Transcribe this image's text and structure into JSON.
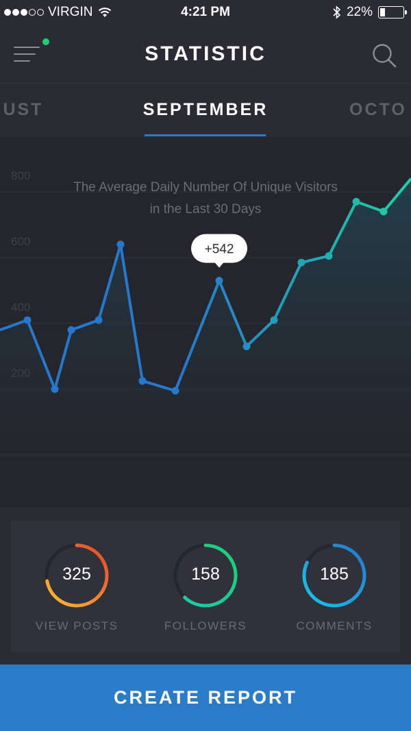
{
  "status_bar": {
    "carrier": "VIRGIN",
    "time": "4:21 PM",
    "battery": "22%",
    "battery_level": 0.22
  },
  "header": {
    "title": "STATISTIC",
    "menu_icon": "hamburger-menu-icon",
    "search_icon": "search-icon",
    "notification_color": "#1bd16f"
  },
  "months": {
    "prev": "GUST",
    "active": "SEPTEMBER",
    "next": "OCTO"
  },
  "chart_data": {
    "type": "line",
    "title": "The Average Daily Number Of Unique Visitors\nin the Last 30 Days",
    "y_ticks": [
      "800",
      "600",
      "400",
      "200"
    ],
    "ylim": [
      0,
      800
    ],
    "grid": true,
    "x": [
      1,
      2,
      3,
      4,
      5,
      6,
      7,
      8,
      9,
      10,
      11,
      12,
      13,
      14,
      15,
      16
    ],
    "values": [
      330,
      360,
      150,
      330,
      360,
      590,
      175,
      145,
      480,
      280,
      360,
      535,
      555,
      720,
      690,
      790
    ],
    "highlight": {
      "index": 8,
      "label": "+542"
    },
    "colors": {
      "start": "#2678cc",
      "end": "#1dd1a5"
    }
  },
  "stats": [
    {
      "value": "325",
      "label": "VIEW POSTS",
      "progress": 0.72,
      "color_start": "#f5c033",
      "color_end": "#e8452b"
    },
    {
      "value": "158",
      "label": "FOLLOWERS",
      "progress": 0.62,
      "color_start": "#1ec8b0",
      "color_end": "#1bd16f"
    },
    {
      "value": "185",
      "label": "COMMENTS",
      "progress": 0.82,
      "color_start": "#18c6ea",
      "color_end": "#2678cc"
    }
  ],
  "action": {
    "label": "CREATE REPORT"
  }
}
